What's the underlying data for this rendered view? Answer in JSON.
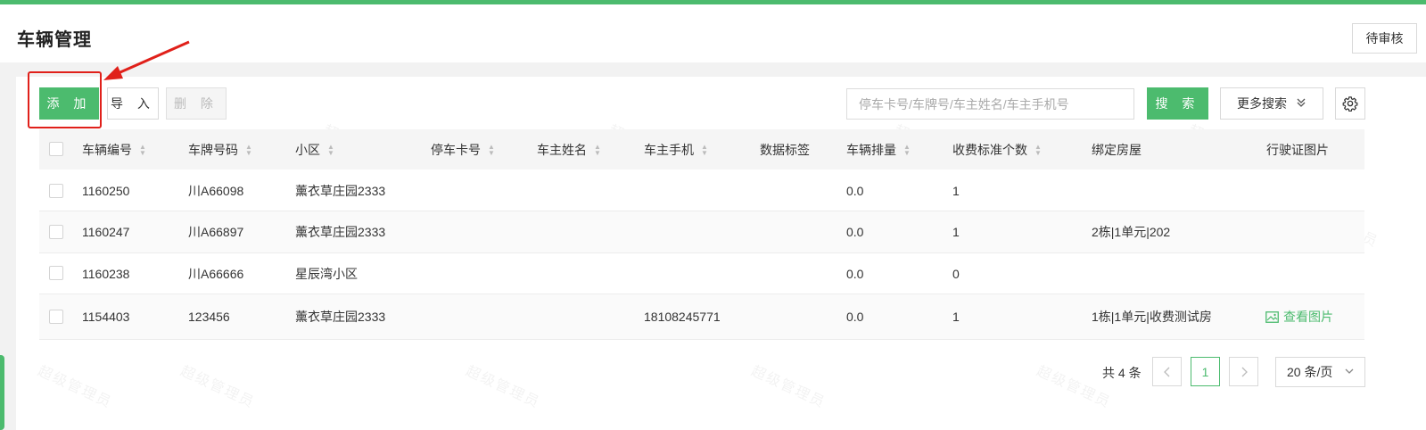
{
  "header": {
    "title": "车辆管理",
    "pending_label": "待审核"
  },
  "toolbar": {
    "add_label": "添 加",
    "import_label": "导 入",
    "delete_label": "删 除",
    "search_placeholder": "停车卡号/车牌号/车主姓名/车主手机号",
    "search_label": "搜 索",
    "more_search_label": "更多搜索",
    "settings_icon": "gear-icon"
  },
  "table": {
    "columns": [
      "车辆编号",
      "车牌号码",
      "小区",
      "停车卡号",
      "车主姓名",
      "车主手机",
      "数据标签",
      "车辆排量",
      "收费标准个数",
      "绑定房屋",
      "行驶证图片"
    ],
    "rows": [
      {
        "id": "1160250",
        "plate": "川A66098",
        "community": "薰衣草庄园2333",
        "card": "",
        "owner": "",
        "phone": "",
        "tag": "",
        "displacement": "0.0",
        "fee_count": "1",
        "house": "",
        "license": ""
      },
      {
        "id": "1160247",
        "plate": "川A66897",
        "community": "薰衣草庄园2333",
        "card": "",
        "owner": "",
        "phone": "",
        "tag": "",
        "displacement": "0.0",
        "fee_count": "1",
        "house": "2栋|1单元|202",
        "license": ""
      },
      {
        "id": "1160238",
        "plate": "川A66666",
        "community": "星辰湾小区",
        "card": "",
        "owner": "",
        "phone": "",
        "tag": "",
        "displacement": "0.0",
        "fee_count": "0",
        "house": "",
        "license": ""
      },
      {
        "id": "1154403",
        "plate": "123456",
        "community": "薰衣草庄园2333",
        "card": "",
        "owner": "",
        "phone": "18108245771",
        "tag": "",
        "displacement": "0.0",
        "fee_count": "1",
        "house": "1栋|1单元|收费测试房",
        "license": "查看图片"
      }
    ]
  },
  "pagination": {
    "total_label": "共 4 条",
    "current_page": "1",
    "page_size_label": "20 条/页",
    "prev_icon": "chevron-left-icon",
    "next_icon": "chevron-right-icon"
  },
  "watermark": "超级管理员",
  "colors": {
    "accent": "#4cbb6e",
    "highlight": "#e0201a"
  }
}
